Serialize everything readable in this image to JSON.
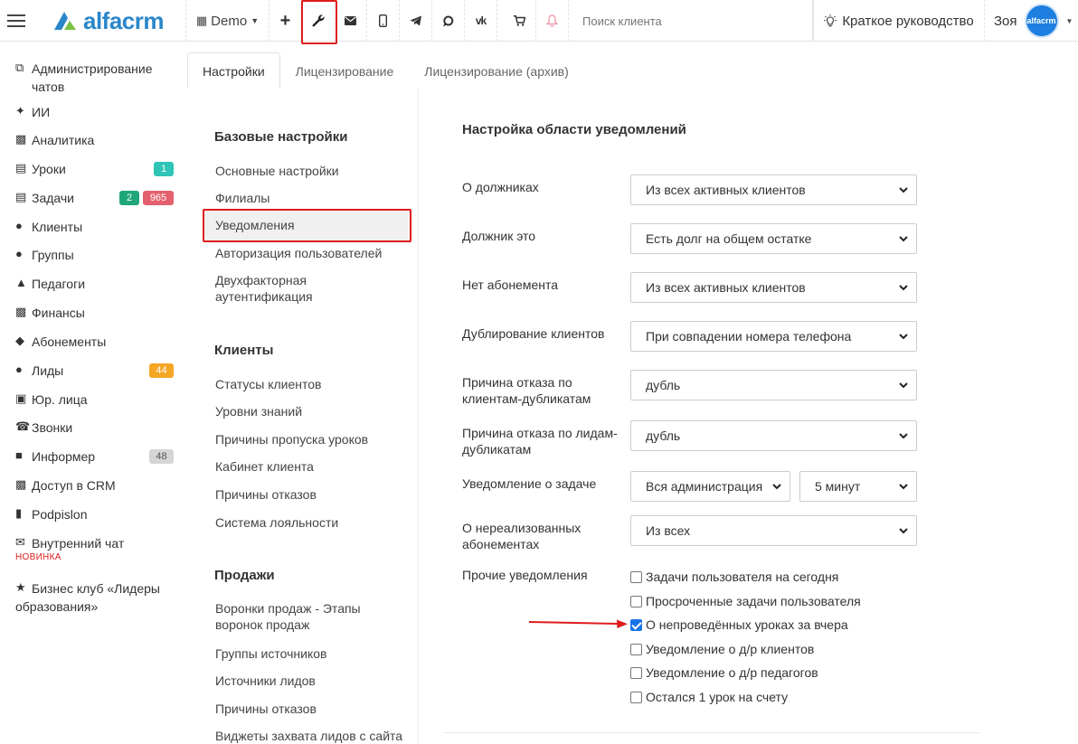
{
  "topbar": {
    "brand": "alfacrm",
    "branch": "Demo",
    "search_placeholder": "Поиск клиента",
    "guide_label": "Краткое руководство",
    "user_name": "Зоя",
    "avatar_text": "alfacrm",
    "icons": [
      "plus-icon",
      "wrench-icon",
      "mail-icon",
      "phone-icon",
      "telegram-icon",
      "whatsapp-icon",
      "vk-icon",
      "cart-icon",
      "bell-icon"
    ]
  },
  "sidebar": {
    "items": [
      {
        "label": "Администрирование чатов",
        "icon": "chats-admin-icon"
      },
      {
        "label": "ИИ",
        "icon": "ai-sparkle-icon"
      },
      {
        "label": "Аналитика",
        "icon": "analytics-icon"
      },
      {
        "label": "Уроки",
        "icon": "calendar-icon",
        "badges": [
          "1"
        ]
      },
      {
        "label": "Задачи",
        "icon": "tasks-icon",
        "badges": [
          "2",
          "965"
        ]
      },
      {
        "label": "Клиенты",
        "icon": "user-icon"
      },
      {
        "label": "Группы",
        "icon": "group-icon"
      },
      {
        "label": "Педагоги",
        "icon": "graduation-cap-icon"
      },
      {
        "label": "Финансы",
        "icon": "money-icon"
      },
      {
        "label": "Абонементы",
        "icon": "tag-icon"
      },
      {
        "label": "Лиды",
        "icon": "lead-icon",
        "badges": [
          "44"
        ]
      },
      {
        "label": "Юр. лица",
        "icon": "briefcase-icon"
      },
      {
        "label": "Звонки",
        "icon": "phone-call-icon"
      },
      {
        "label": "Информер",
        "icon": "informer-icon",
        "badges": [
          "48"
        ]
      },
      {
        "label": "Доступ в CRM",
        "icon": "lock-icon"
      },
      {
        "label": "Podpislon",
        "icon": "document-icon"
      },
      {
        "label": "Внутренний чат",
        "icon": "envelope-icon",
        "tag": "НОВИНКА"
      },
      {
        "label": "Бизнес клуб «Лидеры образования»",
        "icon": "star-icon"
      }
    ],
    "badge_colors": {
      "teal": "#2ec4b6",
      "green": "#1fa67a",
      "red": "#e4606d",
      "orange": "#f5a623",
      "gray": "#d5d5d5"
    }
  },
  "tabs": [
    "Настройки",
    "Лицензирование",
    "Лицензирование (архив)"
  ],
  "settings_menu": {
    "sections": [
      {
        "title": "Базовые настройки",
        "items": [
          "Основные настройки",
          "Филиалы",
          "Уведомления",
          "Авторизация пользователей",
          "Двухфакторная аутентификация"
        ]
      },
      {
        "title": "Клиенты",
        "items": [
          "Статусы клиентов",
          "Уровни знаний",
          "Причины пропуска уроков",
          "Кабинет клиента",
          "Причины отказов",
          "Система лояльности"
        ]
      },
      {
        "title": "Продажи",
        "items": [
          "Воронки продаж - Этапы воронок продаж",
          "Группы источников",
          "Источники лидов",
          "Причины отказов",
          "Виджеты захвата лидов с сайта"
        ]
      }
    ],
    "active_item": "Уведомления"
  },
  "main": {
    "title": "Настройка области уведомлений",
    "rows": [
      {
        "label": "О должниках",
        "select": "Из всех активных клиентов"
      },
      {
        "label": "Должник это",
        "select": "Есть долг на общем остатке"
      },
      {
        "label": "Нет абонемента",
        "select": "Из всех активных клиентов"
      },
      {
        "label": "Дублирование клиентов",
        "select": "При совпадении номера телефона"
      },
      {
        "label": "Причина отказа по клиентам-дубликатам",
        "select": "дубль"
      },
      {
        "label": "Причина отказа по лидам-дубликатам",
        "select": "дубль"
      },
      {
        "label": "Уведомление о задаче",
        "select": "Вся администрация и",
        "select2": "5 минут"
      },
      {
        "label": "О нереализованных абонементах",
        "select": "Из всех"
      }
    ],
    "other_label": "Прочие уведомления",
    "checkboxes": [
      {
        "label": "Задачи пользователя на сегодня",
        "checked": false
      },
      {
        "label": "Просроченные задачи пользователя",
        "checked": false
      },
      {
        "label": "О непроведённых уроках за вчера",
        "checked": true
      },
      {
        "label": "Уведомление о д/р клиентов",
        "checked": false
      },
      {
        "label": "Уведомление о д/р педагогов",
        "checked": false
      },
      {
        "label": "Остался 1 урок на счету",
        "checked": false
      }
    ]
  },
  "colors": {
    "highlight_red": "#e01c1c",
    "brand_blue": "#2b86c9",
    "checkbox_blue": "#1a73e8"
  }
}
